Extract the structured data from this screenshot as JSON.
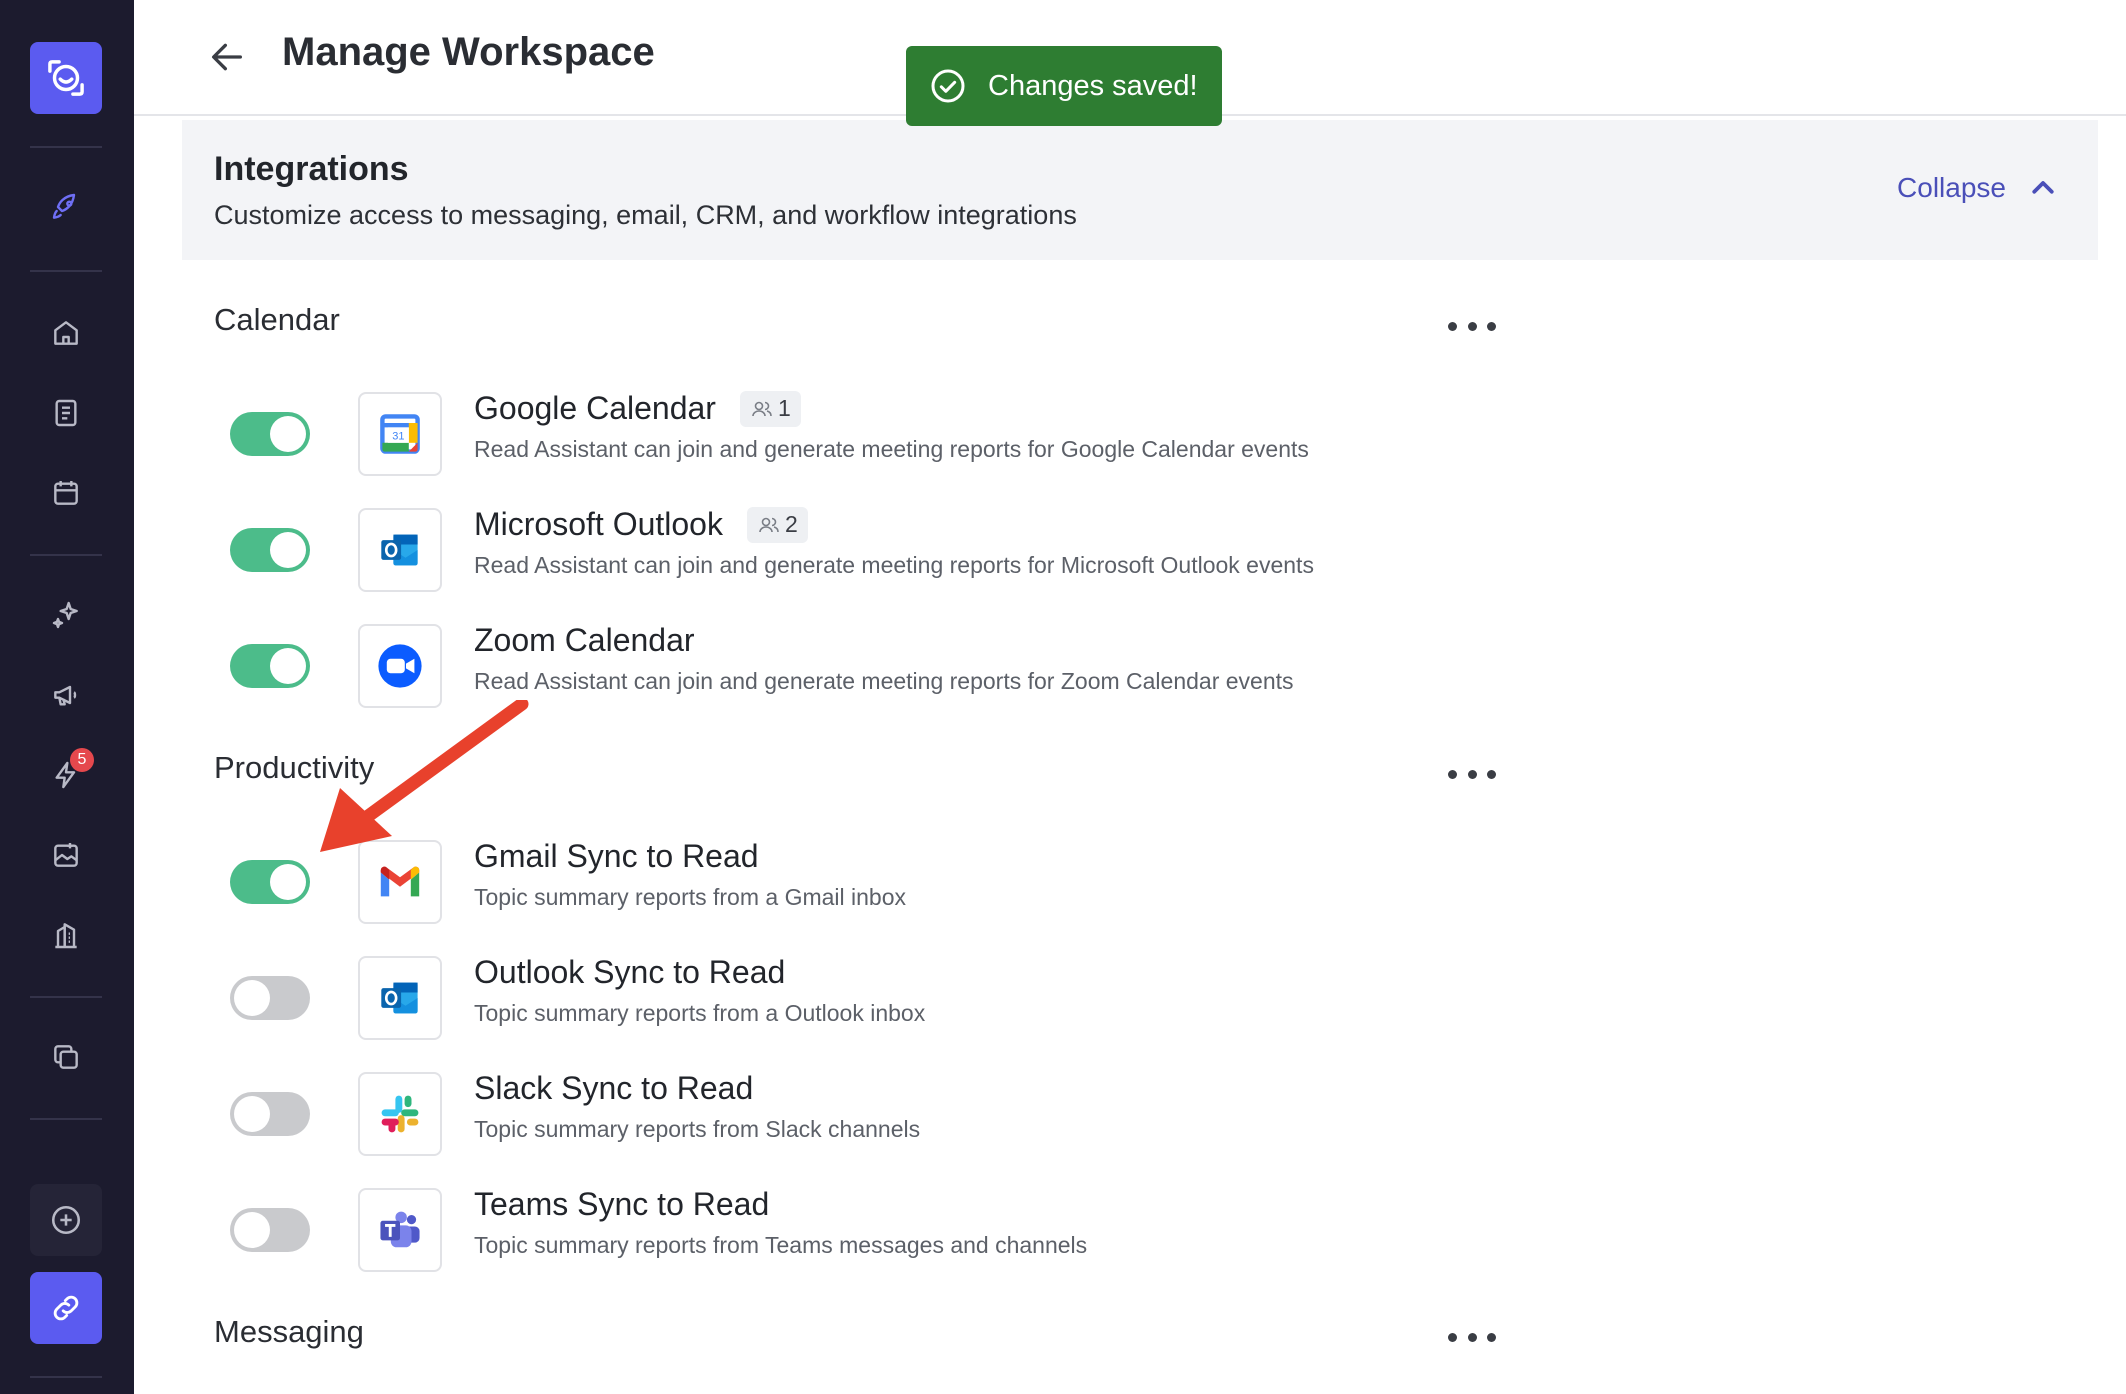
{
  "header": {
    "title": "Manage Workspace"
  },
  "toast": {
    "message": "Changes saved!",
    "color": "#2e7d32"
  },
  "integrations": {
    "title": "Integrations",
    "subtitle": "Customize access to messaging, email, CRM, and workflow integrations",
    "collapse_label": "Collapse"
  },
  "sidebar": {
    "notification_count": "5"
  },
  "sections": {
    "calendar": {
      "title": "Calendar",
      "items": [
        {
          "name": "Google Calendar",
          "users": "1",
          "enabled": true,
          "icon": "google-calendar-icon",
          "desc": "Read Assistant can join and generate meeting reports for Google Calendar events"
        },
        {
          "name": "Microsoft Outlook",
          "users": "2",
          "enabled": true,
          "icon": "outlook-icon",
          "desc": "Read Assistant can join and generate meeting reports for Microsoft Outlook events"
        },
        {
          "name": "Zoom Calendar",
          "enabled": true,
          "icon": "zoom-icon",
          "desc": "Read Assistant can join and generate meeting reports for Zoom Calendar events"
        }
      ]
    },
    "productivity": {
      "title": "Productivity",
      "items": [
        {
          "name": "Gmail Sync to Read",
          "enabled": true,
          "icon": "gmail-icon",
          "desc": "Topic summary reports from a Gmail inbox"
        },
        {
          "name": "Outlook Sync to Read",
          "enabled": false,
          "icon": "outlook-icon",
          "desc": "Topic summary reports from a Outlook inbox"
        },
        {
          "name": "Slack Sync to Read",
          "enabled": false,
          "icon": "slack-icon",
          "desc": "Topic summary reports from Slack channels"
        },
        {
          "name": "Teams Sync to Read",
          "enabled": false,
          "icon": "teams-icon",
          "desc": "Topic summary reports from Teams messages and channels"
        }
      ]
    },
    "messaging": {
      "title": "Messaging"
    }
  },
  "colors": {
    "accent": "#5b5bf0",
    "toggle_on": "#4cbc8a",
    "toggle_off": "#c9cacd",
    "annotation_arrow": "#e8412c"
  }
}
